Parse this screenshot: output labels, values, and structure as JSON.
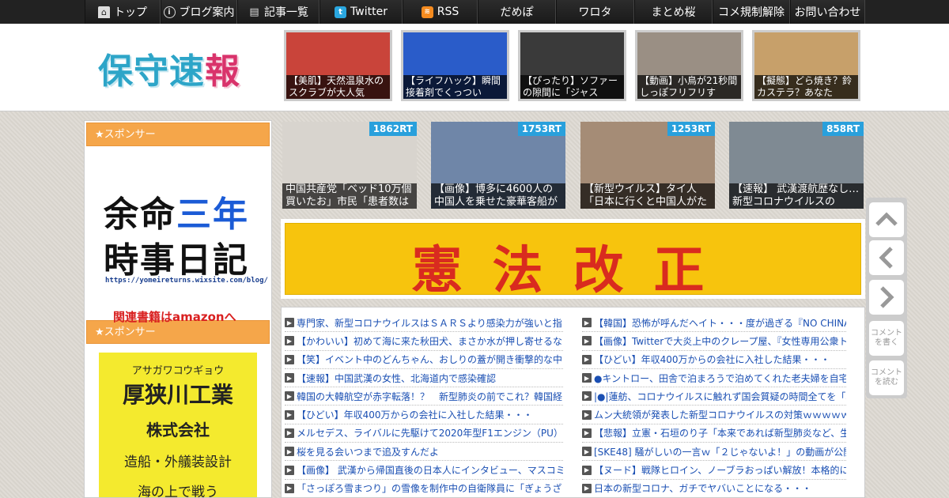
{
  "nav": {
    "items": [
      {
        "label": "トップ",
        "icon": "home-icon"
      },
      {
        "label": "ブログ案内",
        "icon": "info-icon"
      },
      {
        "label": "記事一覧",
        "icon": "list-icon"
      },
      {
        "label": "Twitter",
        "icon": "twitter-icon"
      },
      {
        "label": "RSS",
        "icon": "rss-icon"
      },
      {
        "label": "だめぽ"
      },
      {
        "label": "ワロタ"
      },
      {
        "label": "まとめ桜"
      },
      {
        "label": "コメ規制解除"
      },
      {
        "label": "お問い合わせ"
      }
    ]
  },
  "header": {
    "logo": [
      "保",
      "守",
      "速",
      "報"
    ],
    "thumbs": [
      {
        "caption": "【美肌】天然温泉水のスクラブが大人気",
        "color": "#c9443a"
      },
      {
        "caption": "【ライフハック】瞬間接着剤でくっつい",
        "color": "#2a5cc9"
      },
      {
        "caption": "【ぴったり】ソファーの隙間に「ジャス",
        "color": "#3a3a3a"
      },
      {
        "caption": "【動画】小鳥が21秒間しっぽフリフリす",
        "color": "#9a8f84"
      },
      {
        "caption": "【擬態】どら焼き？鈴カステラ？あなた",
        "color": "#c7a06a"
      }
    ]
  },
  "sidebar": {
    "sponsor_label": "★スポンサー",
    "ad1": {
      "line1_a": "余命",
      "line1_b": "三年",
      "line2": "時事日記",
      "url": "https://yomeireturns.wixsite.com/blog/",
      "amazon": "関連書籍はamazonへ"
    },
    "ad2": {
      "kana": "アサガワコウギョウ",
      "name": "厚狭川工業",
      "company": "株式会社",
      "desc": "造船・外艤装設計",
      "tagline": "海の上で戦う"
    }
  },
  "ranking": [
    {
      "rt": "1862RT",
      "caption": "中国共産党「ベッド10万個買いたお」市民「患者数は",
      "color": "#d8d4ce"
    },
    {
      "rt": "1753RT",
      "caption": "【画像】博多に4600人の中国人を乗せた豪華客船が到",
      "color": "#6f86a8"
    },
    {
      "rt": "1253RT",
      "caption": "【新型ウイルス】タイ人「日本に行くと中国人がた",
      "color": "#a58c76"
    },
    {
      "rt": "858RT",
      "caption": "【速報】 武漢渡航歴なし…新型コロナウイルスの",
      "color": "#7f8a93"
    }
  ],
  "banner": {
    "text": "憲法改正"
  },
  "news": {
    "left": [
      "専門家、新型コロナウイルスはＳＡＲＳより感染力が強いと指",
      "【かわいい】初めて海に来た秋田犬、まさか水が押し寄せるな",
      "【笑】イベント中のどんちゃん、おしりの蓋が開き衝撃的な中",
      "【速報】中国武漢の女性、北海道内で感染確認",
      "韓国の大韓航空が赤字転落！？　新型肺炎の前でこれ？韓国経",
      "【ひどい】年収400万からの会社に入社した結果・・・",
      "メルセデス、ライバルに先駆けて2020年型F1エンジン（PU）の",
      "桜を見る会いつまで追及すんだよ",
      "【画像】 武漢から帰国直後の日本人にインタビュー、マスコミ",
      "「さっぽろ雪まつり」の雪像を制作中の自衛隊員に「ぎょうざ"
    ],
    "right": [
      "【韓国】恐怖が呼んだヘイト・・・度が過ぎる『NO CHINA』",
      "【画像】Twitterで大炎上中のクレープ屋、『女性専用公衆トイ",
      "【ひどい】年収400万からの会社に入社した結果・・・",
      "●キントロー、田舎で泊まろうで泊めてくれた老夫婦を自宅に深",
      "|●|蓮舫、コロナウイルスに触れず国会質疑の時間全てを「桜が",
      "ムン大統領が発表した新型コロナウイルスの対策ｗｗｗｗｗｗ",
      "【悲報】立憲・石垣のり子「本来であれば新型肺炎など、生命",
      "[SKE48] 騒がしいの一言ｗ「２じゃないよ！」の動画が公開",
      "【ヌード】戦隊ヒロイン、ノーブラおっぱい解放！本格的に脱ぎ",
      "日本の新型コロナ、ガチでヤバいことになる・・・"
    ]
  },
  "side_widgets": {
    "write_comment": [
      "コメント",
      "を書く"
    ],
    "read_comment": [
      "コメント",
      "を読む"
    ]
  }
}
